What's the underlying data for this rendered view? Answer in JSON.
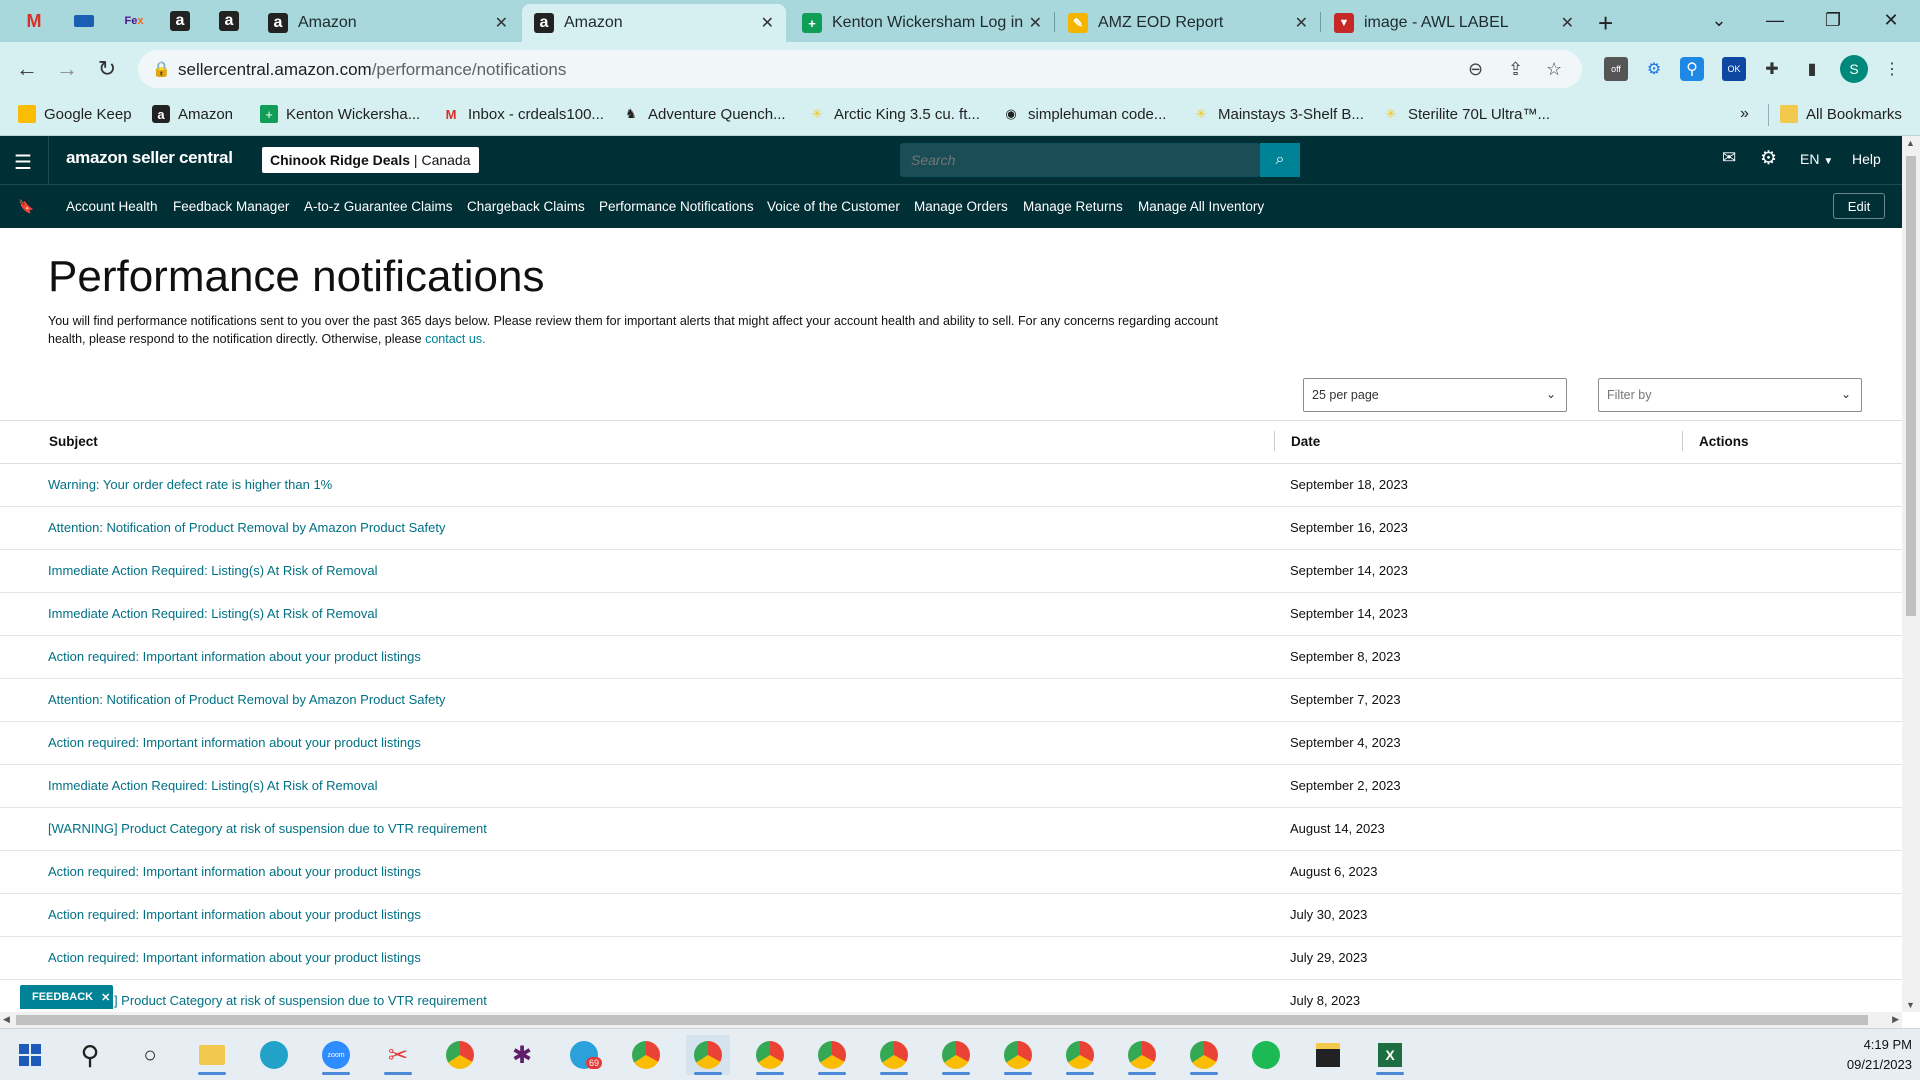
{
  "browser": {
    "tabs": [
      {
        "title": "Amazon",
        "favicon": "amazon-icon",
        "active": false
      },
      {
        "title": "Amazon",
        "favicon": "amazon-icon",
        "active": true
      },
      {
        "title": "Kenton Wickersham Log ins",
        "favicon": "sheets-icon",
        "active": false
      },
      {
        "title": "AMZ EOD Report",
        "favicon": "pen-icon",
        "active": false
      },
      {
        "title": "image - AWL LABEL",
        "favicon": "image-icon",
        "active": false
      }
    ],
    "url_host": "sellercentral.amazon.com",
    "url_path": "/performance/notifications",
    "bookmarks": [
      {
        "label": "Google Keep",
        "icon": "keep-icon"
      },
      {
        "label": "Amazon",
        "icon": "amazon-icon"
      },
      {
        "label": "Kenton Wickersha...",
        "icon": "sheets-icon"
      },
      {
        "label": "Inbox - crdeals100...",
        "icon": "gmail-icon"
      },
      {
        "label": "Adventure Quench...",
        "icon": "horse-icon"
      },
      {
        "label": "Arctic King 3.5 cu. ft...",
        "icon": "walmart-icon"
      },
      {
        "label": "simplehuman code...",
        "icon": "globe-icon"
      },
      {
        "label": "Mainstays 3-Shelf B...",
        "icon": "walmart-icon"
      },
      {
        "label": "Sterilite 70L Ultra™...",
        "icon": "walmart-icon"
      }
    ],
    "all_bookmarks_label": "All Bookmarks",
    "profile_initial": "S"
  },
  "header": {
    "logo": "amazon seller central",
    "store_name": "Chinook Ridge Deals",
    "store_region": "Canada",
    "search_placeholder": "Search",
    "language": "EN",
    "help": "Help"
  },
  "nav": {
    "items": [
      "Account Health",
      "Feedback Manager",
      "A-to-z Guarantee Claims",
      "Chargeback Claims",
      "Performance Notifications",
      "Voice of the Customer",
      "Manage Orders",
      "Manage Returns",
      "Manage All Inventory"
    ],
    "edit": "Edit"
  },
  "page": {
    "title": "Performance notifications",
    "intro": "You will find performance notifications sent to you over the past 365 days below. Please review them for important alerts that might affect your account health and ability to sell. For any concerns regarding account health, please respond to the notification directly. Otherwise, please",
    "intro_link": "contact us.",
    "per_page": "25 per page",
    "filter_placeholder": "Filter by",
    "columns": {
      "subject": "Subject",
      "date": "Date",
      "actions": "Actions"
    },
    "rows": [
      {
        "subject": "Warning: Your order defect rate is higher than 1%",
        "date": "September 18, 2023"
      },
      {
        "subject": "Attention: Notification of Product Removal by Amazon Product Safety",
        "date": "September 16, 2023"
      },
      {
        "subject": "Immediate Action Required: Listing(s) At Risk of Removal",
        "date": "September 14, 2023"
      },
      {
        "subject": "Immediate Action Required: Listing(s) At Risk of Removal",
        "date": "September 14, 2023"
      },
      {
        "subject": "Action required: Important information about your product listings",
        "date": "September 8, 2023"
      },
      {
        "subject": "Attention: Notification of Product Removal by Amazon Product Safety",
        "date": "September 7, 2023"
      },
      {
        "subject": "Action required: Important information about your product listings",
        "date": "September 4, 2023"
      },
      {
        "subject": "Immediate Action Required: Listing(s) At Risk of Removal",
        "date": "September 2, 2023"
      },
      {
        "subject": "[WARNING] Product Category at risk of suspension due to VTR requirement",
        "date": "August 14, 2023"
      },
      {
        "subject": "Action required: Important information about your product listings",
        "date": "August 6, 2023"
      },
      {
        "subject": "Action required: Important information about your product listings",
        "date": "July 30, 2023"
      },
      {
        "subject": "Action required: Important information about your product listings",
        "date": "July 29, 2023"
      },
      {
        "subject": "[WARNING] Product Category at risk of suspension due to VTR requirement",
        "date": "July 8, 2023"
      }
    ],
    "feedback": "FEEDBACK"
  },
  "taskbar": {
    "time": "4:19 PM",
    "date": "09/21/2023",
    "telegram_badge": "69"
  },
  "colors": {
    "header_bg": "#002f36",
    "link": "#007185",
    "accent": "#008296",
    "tab_strip": "#a8d8dc"
  }
}
